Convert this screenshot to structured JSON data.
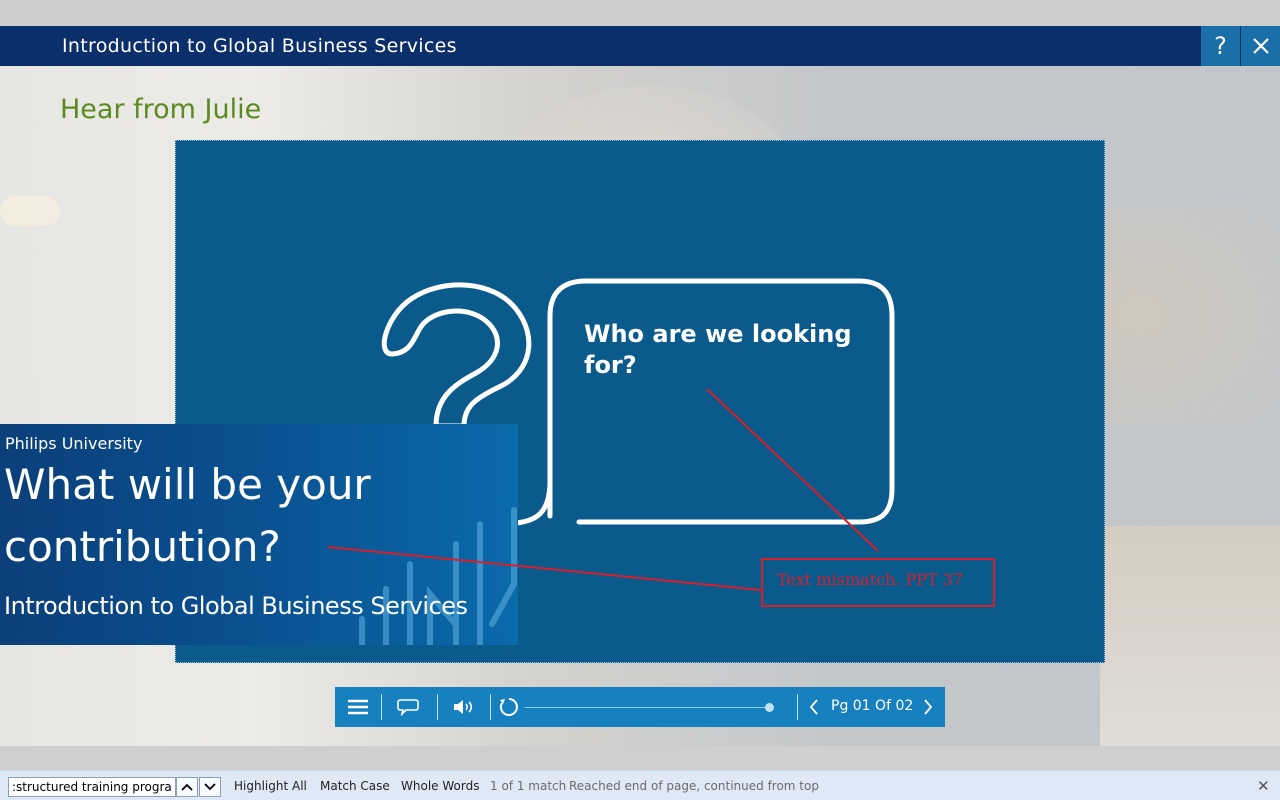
{
  "window": {
    "title": "Introduction to Global Business Services",
    "help_icon": "?",
    "close_icon": "✕"
  },
  "slide": {
    "heading": "Hear from Julie",
    "video": {
      "bubble_text": "Who are we looking for?",
      "lower_third": {
        "organization": "Philips University",
        "question_line1": "What will be your",
        "question_line2": "contribution?",
        "course_title": "Introduction to Global Business Services"
      }
    },
    "annotation": {
      "text": "Text mismatch. PPT 37",
      "color": "#d71f2b"
    }
  },
  "player": {
    "menu_icon": "menu-icon",
    "transcript_icon": "speech-bubble-icon",
    "volume_icon": "speaker-icon",
    "replay_icon": "replay-icon",
    "progress": 1.0,
    "page_label": "Pg 01 Of 02",
    "prev_icon": "chevron-left-icon",
    "next_icon": "chevron-right-icon"
  },
  "find_bar": {
    "query": ":structured training programs",
    "highlight_all": "Highlight All",
    "match_case": "Match Case",
    "whole_words": "Whole Words",
    "match_count": "1 of 1 match",
    "status": "Reached end of page, continued from top"
  },
  "colors": {
    "title_bar": "#0b2f6b",
    "accent_blue": "#1681be",
    "heading_green": "#5b8a1f",
    "video_bg": "#0b5a8c"
  }
}
